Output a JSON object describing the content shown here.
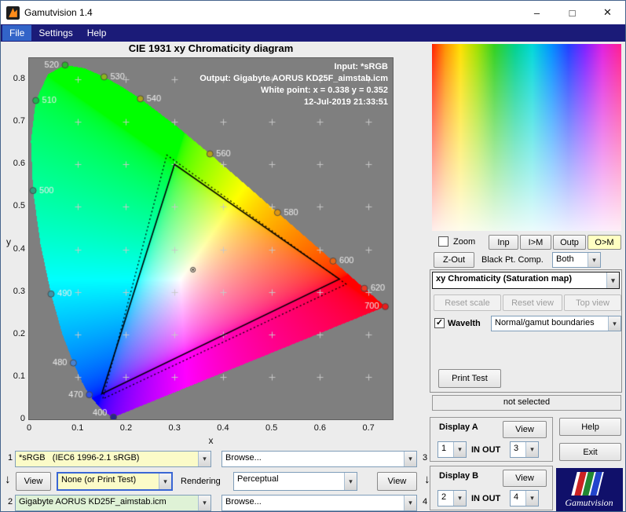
{
  "window": {
    "title": "Gamutvision 1.4"
  },
  "icons": {
    "chevron_down": "▾",
    "arrow_down": "↓",
    "check": "✓",
    "minimize": "–",
    "maximize": "□",
    "close": "✕"
  },
  "colors": {
    "menu_bar": "#1b1b78",
    "menu_highlight": "#3264c8",
    "selected_button": "#ffffc2",
    "input_field": "#fbfbc8",
    "output_field": "#dff2d6",
    "plot_background": "#7f7f7f"
  },
  "menu": {
    "items": [
      {
        "label": "File"
      },
      {
        "label": "Settings"
      },
      {
        "label": "Help"
      }
    ]
  },
  "chart_data": {
    "type": "chromaticity-diagram",
    "title": "CIE 1931 xy Chromaticity diagram",
    "xlabel": "x",
    "ylabel": "y",
    "xlim": [
      0,
      0.75
    ],
    "ylim": [
      0,
      0.85
    ],
    "xticks": [
      0,
      0.1,
      0.2,
      0.3,
      0.4,
      0.5,
      0.6,
      0.7
    ],
    "yticks": [
      0,
      0.1,
      0.2,
      0.3,
      0.4,
      0.5,
      0.6,
      0.7,
      0.8
    ],
    "grid": "plus markers every 0.1",
    "annotations": [
      "Input:  *sRGB",
      "Output: Gigabyte AORUS KD25F_aimstab.icm",
      "White point:  x = 0.338  y = 0.352",
      "12-Jul-2019 21:33:51"
    ],
    "white_point": {
      "x": 0.338,
      "y": 0.352
    },
    "gamut_triangles": [
      {
        "name": "input sRGB gamut",
        "style": "solid",
        "points": [
          [
            0.64,
            0.33
          ],
          [
            0.3,
            0.6
          ],
          [
            0.15,
            0.06
          ]
        ]
      },
      {
        "name": "output monitor gamut",
        "style": "dotted",
        "points": [
          [
            0.654,
            0.318
          ],
          [
            0.284,
            0.622
          ],
          [
            0.152,
            0.048
          ]
        ]
      }
    ],
    "wavelength_labels": [
      {
        "nm": "520",
        "x": 0.0743,
        "y": 0.8338,
        "side": "left",
        "color": "#2ab42a"
      },
      {
        "nm": "530",
        "x": 0.1547,
        "y": 0.8059,
        "side": "right",
        "color": "#8cb41e"
      },
      {
        "nm": "540",
        "x": 0.2296,
        "y": 0.7543,
        "side": "right",
        "color": "#a8a41c"
      },
      {
        "nm": "510",
        "x": 0.0139,
        "y": 0.7502,
        "side": "right",
        "color": "#1eb450"
      },
      {
        "nm": "560",
        "x": 0.3731,
        "y": 0.6245,
        "side": "right",
        "color": "#b4a019"
      },
      {
        "nm": "500",
        "x": 0.0082,
        "y": 0.5384,
        "side": "right",
        "color": "#2f9e7d"
      },
      {
        "nm": "580",
        "x": 0.5125,
        "y": 0.4866,
        "side": "right",
        "color": "#dc9614"
      },
      {
        "nm": "600",
        "x": 0.627,
        "y": 0.3725,
        "side": "right",
        "color": "#e66414"
      },
      {
        "nm": "490",
        "x": 0.0454,
        "y": 0.295,
        "side": "right",
        "color": "#3c96aa"
      },
      {
        "nm": "620",
        "x": 0.6915,
        "y": 0.3083,
        "side": "right",
        "color": "#e63c28"
      },
      {
        "nm": "700",
        "x": 0.7347,
        "y": 0.2653,
        "side": "left",
        "color": "#e61e1e"
      },
      {
        "nm": "480",
        "x": 0.0913,
        "y": 0.1327,
        "side": "left",
        "color": "#4682d2"
      },
      {
        "nm": "470",
        "x": 0.1241,
        "y": 0.0578,
        "side": "left",
        "color": "#2d4fe6"
      },
      {
        "nm": "400",
        "x": 0.1741,
        "y": 0.005,
        "side": "left",
        "color": "#28288c"
      }
    ],
    "spectral_locus": [
      [
        380,
        0.1741,
        0.005
      ],
      [
        400,
        0.1733,
        0.0048
      ],
      [
        420,
        0.1714,
        0.0051
      ],
      [
        440,
        0.1644,
        0.0109
      ],
      [
        450,
        0.1566,
        0.0177
      ],
      [
        460,
        0.144,
        0.0297
      ],
      [
        470,
        0.1241,
        0.0578
      ],
      [
        475,
        0.1096,
        0.0868
      ],
      [
        480,
        0.0913,
        0.1327
      ],
      [
        485,
        0.0687,
        0.2007
      ],
      [
        490,
        0.0454,
        0.295
      ],
      [
        495,
        0.0235,
        0.4127
      ],
      [
        500,
        0.0082,
        0.5384
      ],
      [
        505,
        0.0039,
        0.6548
      ],
      [
        510,
        0.0139,
        0.7502
      ],
      [
        515,
        0.0389,
        0.812
      ],
      [
        520,
        0.0743,
        0.8338
      ],
      [
        525,
        0.1142,
        0.8262
      ],
      [
        530,
        0.1547,
        0.8059
      ],
      [
        535,
        0.1929,
        0.7816
      ],
      [
        540,
        0.2296,
        0.7543
      ],
      [
        550,
        0.3016,
        0.6923
      ],
      [
        560,
        0.3731,
        0.6245
      ],
      [
        570,
        0.4441,
        0.5547
      ],
      [
        580,
        0.5125,
        0.4866
      ],
      [
        590,
        0.5752,
        0.4242
      ],
      [
        600,
        0.627,
        0.3725
      ],
      [
        610,
        0.6658,
        0.334
      ],
      [
        620,
        0.6915,
        0.3083
      ],
      [
        640,
        0.719,
        0.2809
      ],
      [
        660,
        0.73,
        0.27
      ],
      [
        700,
        0.7347,
        0.2653
      ]
    ]
  },
  "right_panel": {
    "zoom_label": "Zoom",
    "buttons": {
      "inp": "Inp",
      "i_to_m": "I>M",
      "outp": "Outp",
      "o_to_m": "O>M",
      "z_out": "Z-Out"
    },
    "black_pt_label": "Black Pt. Comp.",
    "black_pt_value": "Both",
    "view_mode": "xy Chromaticity (Saturation map)",
    "reset_scale": "Reset scale",
    "reset_view": "Reset view",
    "top_view": "Top view",
    "wavelth_label": "Wavelth",
    "wavelth_mode": "Normal/gamut boundaries",
    "print_test": "Print Test",
    "status": "not selected",
    "display_a": {
      "title": "Display A",
      "view": "View",
      "in_value": "1",
      "io_label": "IN OUT",
      "out_value": "3"
    },
    "display_b": {
      "title": "Display B",
      "view": "View",
      "in_value": "2",
      "io_label": "IN OUT",
      "out_value": "4"
    },
    "help": "Help",
    "exit": "Exit",
    "logo_text": "Gamutvision"
  },
  "bottom_panel": {
    "row1": {
      "index": "1",
      "profile": "*sRGB   (IEC6 1996-2.1 sRGB)",
      "browse": "Browse...",
      "index_right": "3"
    },
    "row2": {
      "view_left": "View",
      "test_pattern": "None (or Print Test)",
      "rendering_label": "Rendering",
      "intent": "Perceptual",
      "view_right": "View"
    },
    "row3": {
      "index": "2",
      "profile": "Gigabyte AORUS KD25F_aimstab.icm",
      "browse": "Browse...",
      "index_right": "4"
    }
  }
}
